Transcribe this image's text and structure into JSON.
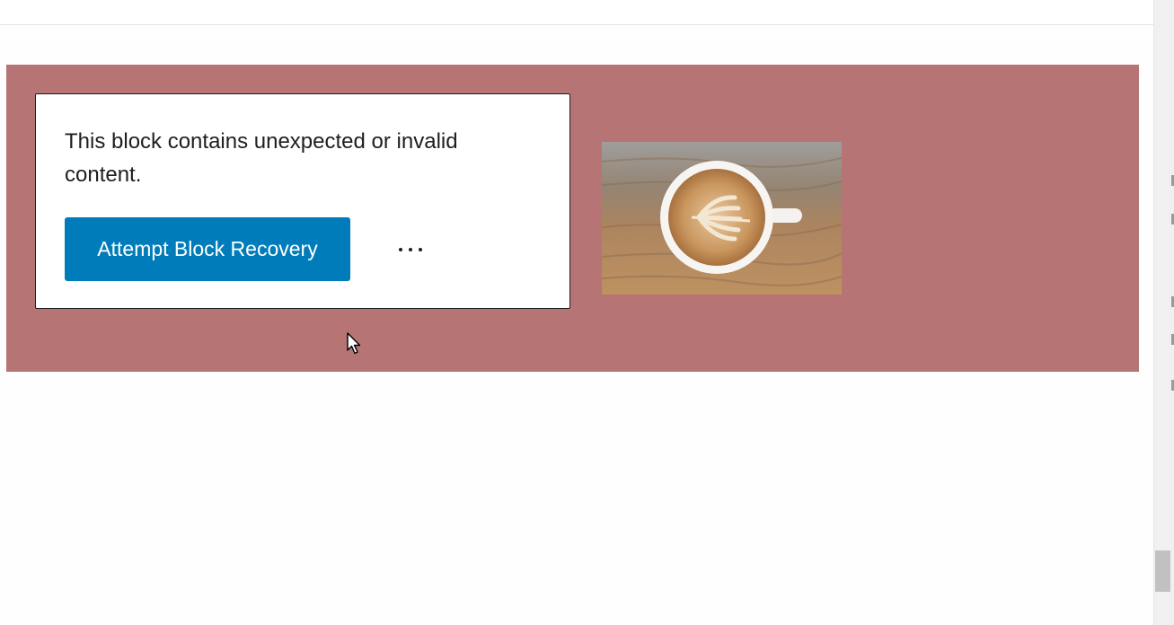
{
  "block_error": {
    "message": "This block contains unexpected or invalid content.",
    "recovery_button_label": "Attempt Block Recovery"
  },
  "icons": {
    "more_options": "more-horizontal-icon",
    "cursor": "mouse-pointer-icon",
    "image": "latte-art-coffee-cup"
  },
  "colors": {
    "block_background": "#b77474",
    "primary_button": "#007cba",
    "card_border": "#1e1e1e",
    "page_background": "#fefefe"
  }
}
